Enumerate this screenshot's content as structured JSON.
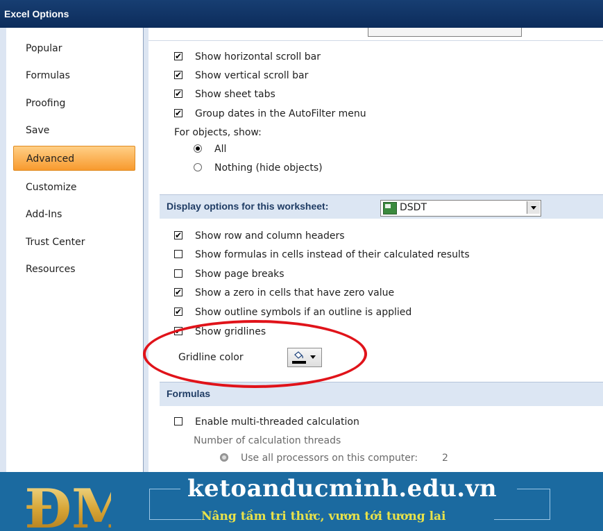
{
  "window": {
    "title": "Excel Options"
  },
  "sidebar": {
    "items": [
      {
        "label": "Popular"
      },
      {
        "label": "Formulas"
      },
      {
        "label": "Proofing"
      },
      {
        "label": "Save"
      },
      {
        "label": "Advanced",
        "active": true
      },
      {
        "label": "Customize"
      },
      {
        "label": "Add-Ins"
      },
      {
        "label": "Trust Center"
      },
      {
        "label": "Resources"
      }
    ]
  },
  "workbook_options": {
    "checkboxes": [
      {
        "label": "Show horizontal scroll bar",
        "checked": true
      },
      {
        "label": "Show vertical scroll bar",
        "checked": true
      },
      {
        "label": "Show sheet tabs",
        "checked": true
      },
      {
        "label": "Group dates in the AutoFilter menu",
        "checked": true
      }
    ],
    "objects_label": "For objects, show:",
    "radios": [
      {
        "label": "All",
        "selected": true
      },
      {
        "label": "Nothing (hide objects)",
        "selected": false
      }
    ]
  },
  "worksheet_section": {
    "title": "Display options for this worksheet:",
    "worksheet_value": "DSDT",
    "checkboxes": [
      {
        "label": "Show row and column headers",
        "checked": true
      },
      {
        "label": "Show formulas in cells instead of their calculated results",
        "checked": false
      },
      {
        "label": "Show page breaks",
        "checked": false
      },
      {
        "label": "Show a zero in cells that have zero value",
        "checked": true
      },
      {
        "label": "Show outline symbols if an outline is applied",
        "checked": true
      },
      {
        "label": "Show gridlines",
        "checked": true
      }
    ],
    "gridline_color_label": "Gridline color"
  },
  "formulas_section": {
    "title": "Formulas",
    "multithread_label": "Enable multi-threaded calculation",
    "multithread_checked": false,
    "threads_label": "Number of calculation threads",
    "use_all_label": "Use all processors on this computer:",
    "use_all_value": "2"
  },
  "footer": {
    "logo_text": "ĐM",
    "site": "ketoanducminh.edu.vn",
    "slogan": "Nâng tầm tri thức, vươn tới tương lai"
  },
  "colors": {
    "title_bar": "#0c2c5b",
    "active_tab": "#f89a2e",
    "section_header_bg": "#dce6f3",
    "annotation_oval": "#e0131a",
    "footer_bg": "#1b6aa0",
    "slogan": "#e8e24a"
  }
}
